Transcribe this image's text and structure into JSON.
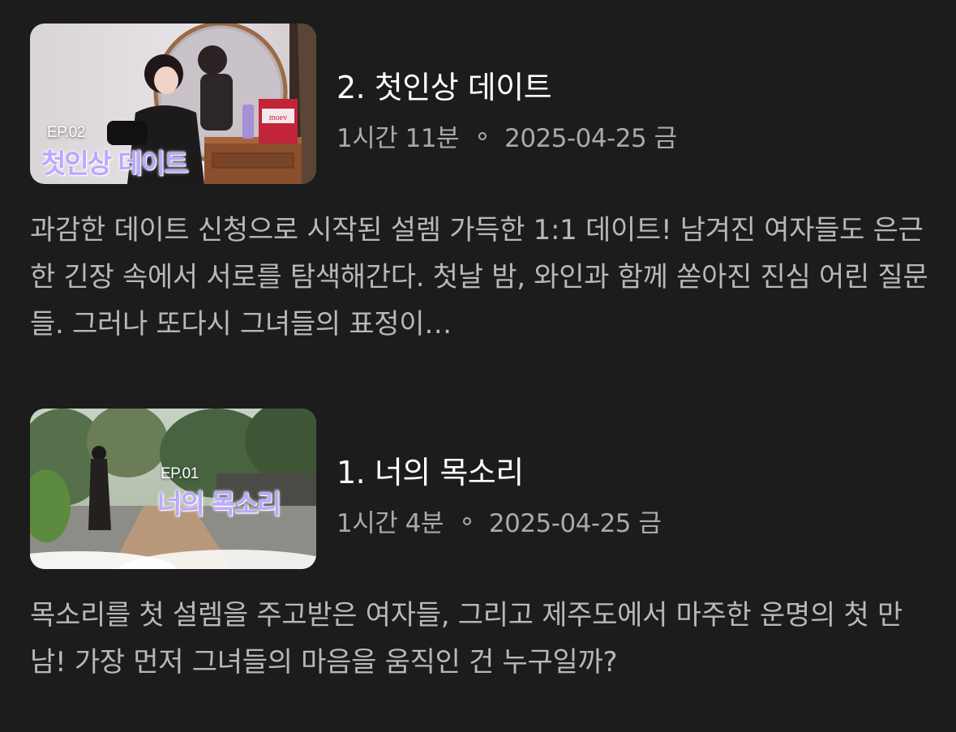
{
  "episodes": [
    {
      "thumb_ep": "EP.02",
      "thumb_title": "첫인상 데이트",
      "title": "2. 첫인상 데이트",
      "duration": "1시간 11분",
      "date": "2025-04-25 금",
      "description": "과감한 데이트 신청으로 시작된 설렘 가득한 1:1 데이트! 남겨진 여자들도 은근한 긴장 속에서 서로를 탐색해간다. 첫날 밤, 와인과 함께 쏟아진 진심 어린 질문들. 그러나 또다시 그녀들의 표정이…",
      "thumb_brand": "moev"
    },
    {
      "thumb_ep": "EP.01",
      "thumb_title": "너의 목소리",
      "title": "1. 너의 목소리",
      "duration": "1시간 4분",
      "date": "2025-04-25 금",
      "description": "목소리를 첫 설렘을 주고받은 여자들, 그리고 제주도에서 마주한 운명의 첫 만남! 가장 먼저 그녀들의 마음을 움직인 건 누구일까?"
    }
  ],
  "colors": {
    "background": "#1c1c1d",
    "title": "#ffffff",
    "meta": "#a9a9ab",
    "description": "#b8b8ba",
    "thumb_title": "#b9a8ff"
  }
}
